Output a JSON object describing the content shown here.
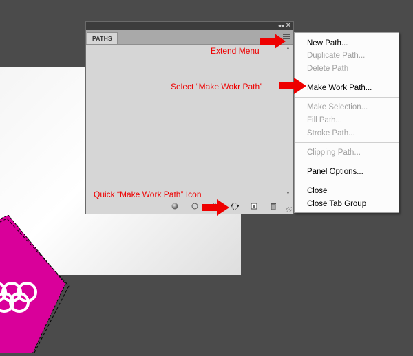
{
  "panel": {
    "tab_label": "PATHS",
    "collapse_glyph": "◂◂",
    "close_glyph": "✕"
  },
  "menu": {
    "items": [
      {
        "label": "New Path...",
        "enabled": true
      },
      {
        "label": "Duplicate Path...",
        "enabled": false
      },
      {
        "label": "Delete Path",
        "enabled": false
      },
      {
        "label": "Make Work Path...",
        "enabled": true
      },
      {
        "label": "Make Selection...",
        "enabled": false
      },
      {
        "label": "Fill Path...",
        "enabled": false
      },
      {
        "label": "Stroke Path...",
        "enabled": false
      },
      {
        "label": "Clipping Path...",
        "enabled": false
      },
      {
        "label": "Panel Options...",
        "enabled": true
      },
      {
        "label": "Close",
        "enabled": true
      },
      {
        "label": "Close Tab Group",
        "enabled": true
      }
    ]
  },
  "annotations": {
    "extend_menu": "Extend Menu",
    "select_make_work_path": "Select “Make Wokr Path”",
    "quick_icon": "Quick “Make Work Path” Icon"
  },
  "colors": {
    "annotation": "#ee0000",
    "logo_magenta": "#d9009a",
    "panel_bg": "#d6d6d6",
    "app_bg": "#4b4b4b"
  },
  "icons": {
    "fill-path": "filled-circle-icon",
    "stroke-path": "hollow-circle-icon",
    "make-work-path": "dotted-circle-icon",
    "new-path": "new-page-icon",
    "delete-path": "trash-icon"
  }
}
